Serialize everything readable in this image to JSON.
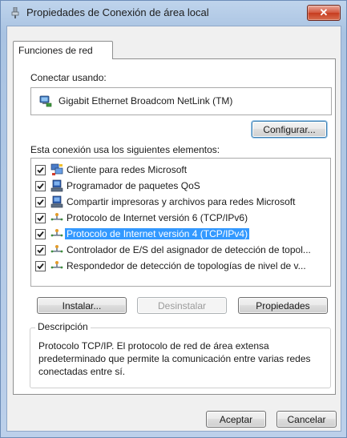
{
  "window": {
    "title": "Propiedades de Conexión de área local",
    "close_label": "✕"
  },
  "tabs": [
    {
      "label": "Funciones de red",
      "active": true
    }
  ],
  "connect_using": {
    "label": "Conectar usando:",
    "adapter": "Gigabit Ethernet Broadcom NetLink (TM)",
    "configure_label": "Configurar..."
  },
  "components": {
    "label": "Esta conexión usa los siguientes elementos:",
    "items": [
      {
        "label": "Cliente para redes Microsoft",
        "checked": true,
        "icon": "network-client-icon"
      },
      {
        "label": "Programador de paquetes QoS",
        "checked": true,
        "icon": "network-service-icon"
      },
      {
        "label": "Compartir impresoras y archivos para redes Microsoft",
        "checked": true,
        "icon": "network-service-icon"
      },
      {
        "label": "Protocolo de Internet versión 6 (TCP/IPv6)",
        "checked": true,
        "icon": "protocol-icon"
      },
      {
        "label": "Protocolo de Internet versión 4 (TCP/IPv4)",
        "checked": true,
        "icon": "protocol-icon",
        "selected": true
      },
      {
        "label": "Controlador de E/S del asignador de detección de topol...",
        "checked": true,
        "icon": "protocol-icon"
      },
      {
        "label": "Respondedor de detección de topologías de nivel de v...",
        "checked": true,
        "icon": "protocol-icon"
      }
    ]
  },
  "actions": {
    "install": "Instalar...",
    "uninstall": "Desinstalar",
    "properties": "Propiedades"
  },
  "description": {
    "title": "Descripción",
    "text": "Protocolo TCP/IP. El protocolo de red de área extensa predeterminado que permite la comunicación entre varias redes conectadas entre sí."
  },
  "dialog_buttons": {
    "ok": "Aceptar",
    "cancel": "Cancelar"
  },
  "colors": {
    "selection": "#3399ff",
    "close_button": "#c63b1f",
    "title_bar": "#bfd4ec"
  }
}
